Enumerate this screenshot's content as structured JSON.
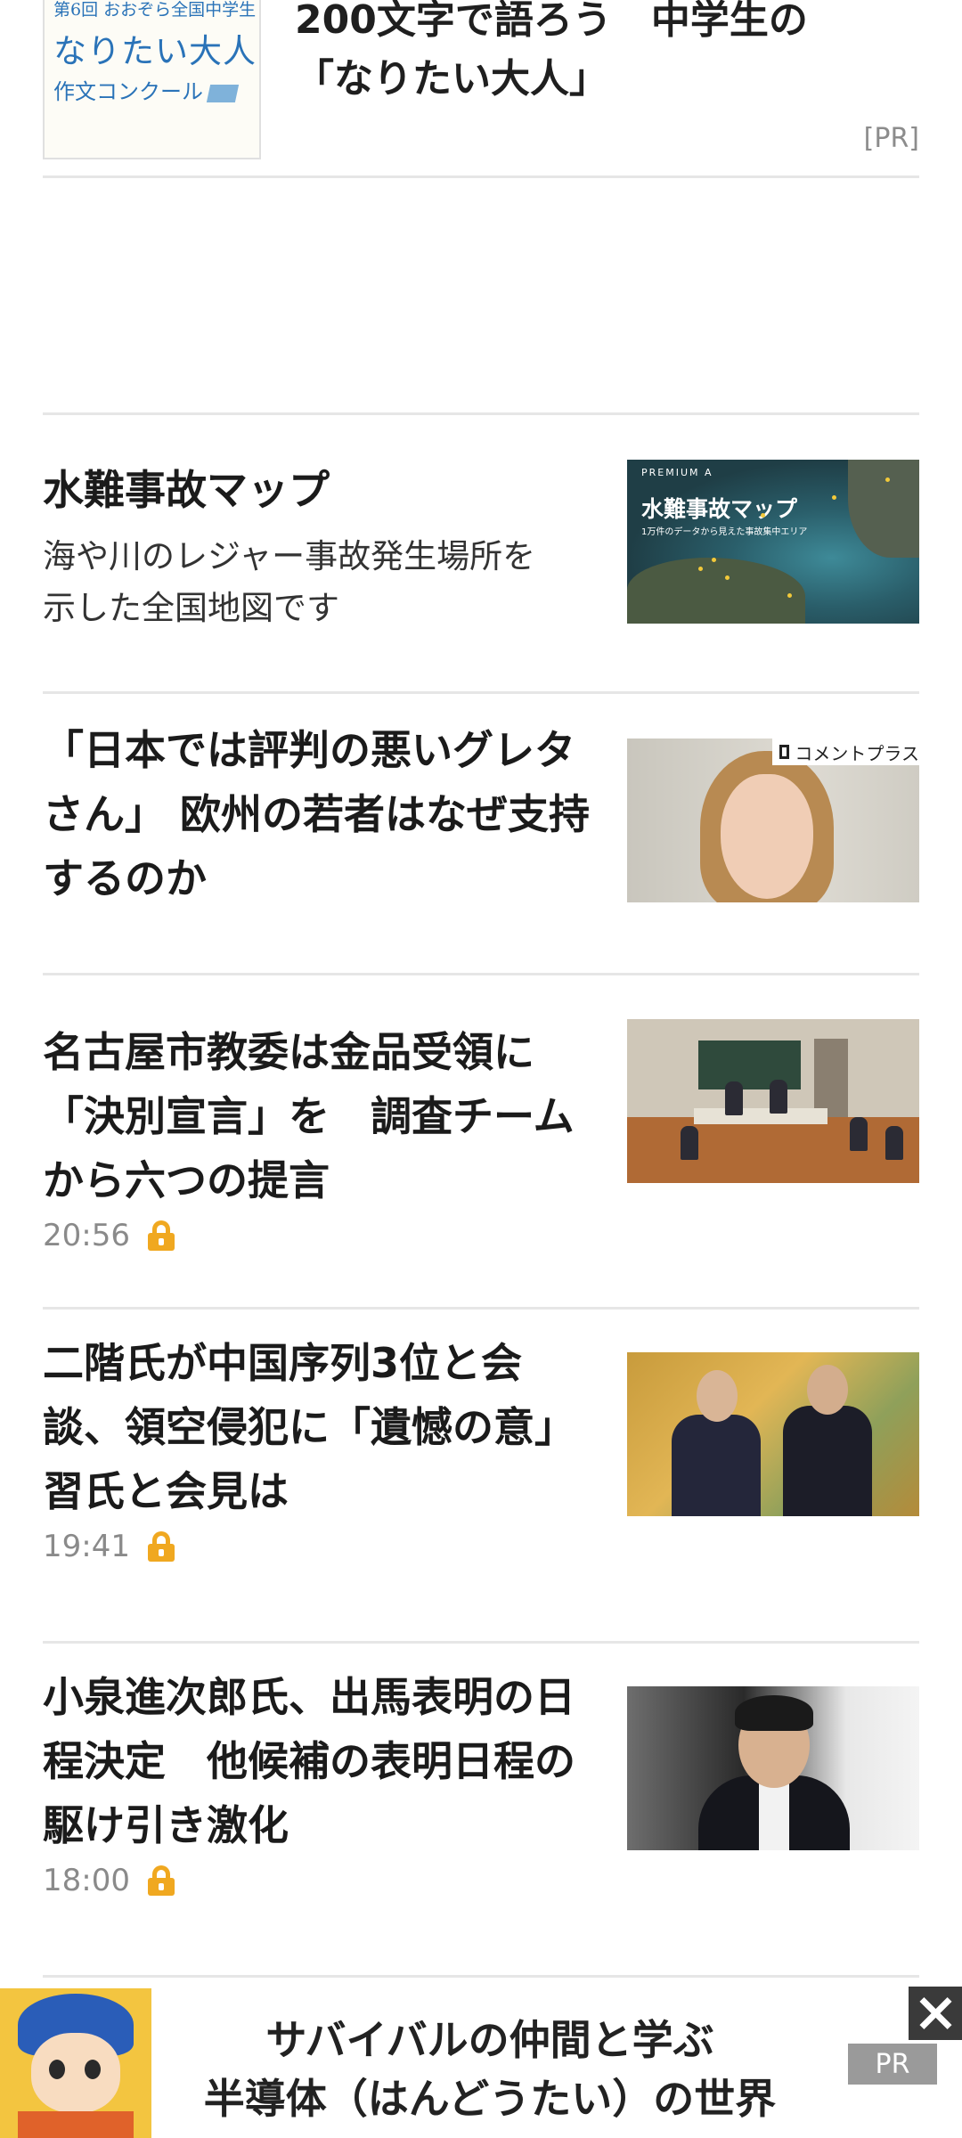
{
  "pr_article": {
    "thumb_line1": "第6回 おおぞら全国中学生",
    "thumb_line2": "なりたい大人",
    "thumb_line3": "作文コンクール",
    "title_line1": "200文字で語ろう　中学生の",
    "title_line2": "「なりたい大人」",
    "pr_label": "[PR]"
  },
  "articles": [
    {
      "title_lines": [
        "水難事故マップ"
      ],
      "desc_lines": [
        "海や川のレジャー事故発生場所を",
        "示した全国地図です"
      ],
      "thumb": {
        "premium": "PREMIUM A",
        "title": "水難事故マップ",
        "subtitle": "1万件のデータから見えた事故集中エリア"
      }
    },
    {
      "title_lines": [
        "「日本では評判の悪いグレタ",
        "さん」 欧州の若者はなぜ支持",
        "するのか"
      ],
      "thumb_badge": "コメントプラス"
    },
    {
      "title_lines": [
        "名古屋市教委は金品受領に",
        "「決別宣言」を　調査チーム",
        "から六つの提言"
      ],
      "time": "20:56"
    },
    {
      "title_lines": [
        "二階氏が中国序列3位と会",
        "談、領空侵犯に「遺憾の意」",
        "習氏と会見は"
      ],
      "time": "19:41"
    },
    {
      "title_lines": [
        "小泉進次郎氏、出馬表明の日",
        "程決定　他候補の表明日程の",
        "駆け引き激化"
      ],
      "time": "18:00"
    }
  ],
  "ad_banner": {
    "line1": "サバイバルの仲間と学ぶ",
    "line2": "半導体（はんどうたい）の世界",
    "pr_label": "PR",
    "close_icon": "close-icon"
  },
  "colors": {
    "lock": "#f0a820",
    "divider": "#e6e6e6",
    "meta_text": "#8a8a8a"
  }
}
